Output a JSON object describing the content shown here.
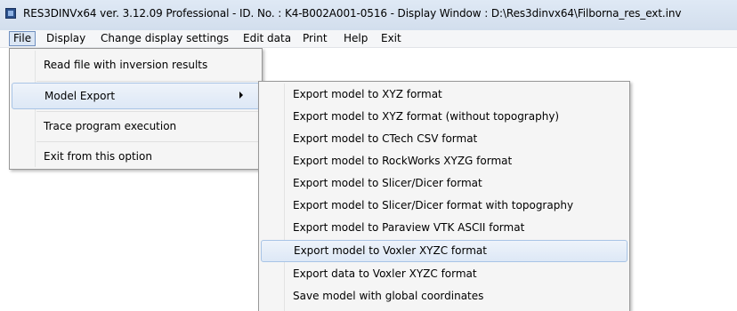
{
  "window": {
    "title": "RES3DINVx64 ver. 3.12.09 Professional - ID. No. : K4-B002A001-0516  - Display Window : D:\\Res3dinvx64\\Filborna_res_ext.inv",
    "icon": "app-icon"
  },
  "menubar": {
    "items": [
      {
        "label": "File"
      },
      {
        "label": "Display"
      },
      {
        "label": "Change display settings"
      },
      {
        "label": "Edit data"
      },
      {
        "label": "Print"
      },
      {
        "label": "Help"
      },
      {
        "label": "Exit"
      }
    ]
  },
  "file_menu": {
    "items": [
      {
        "label": "Read file with inversion results"
      },
      {
        "label": "Model Export"
      },
      {
        "label": "Trace program execution"
      },
      {
        "label": "Exit from this option"
      }
    ]
  },
  "model_export_submenu": {
    "items": [
      {
        "label": "Export model to XYZ format"
      },
      {
        "label": "Export model to XYZ format (without topography)"
      },
      {
        "label": "Export model to CTech CSV format"
      },
      {
        "label": "Export model to RockWorks XYZG format"
      },
      {
        "label": "Export model to Slicer/Dicer format"
      },
      {
        "label": "Export model to Slicer/Dicer format with topography"
      },
      {
        "label": "Export model to Paraview VTK ASCII format"
      },
      {
        "label": "Export model to Voxler XYZC format"
      },
      {
        "label": "Export data to Voxler XYZC format"
      },
      {
        "label": "Save model with global coordinates"
      }
    ]
  },
  "colors": {
    "titlebar": "#d6e2f0",
    "highlight": "#dde8f6",
    "highlight_border": "#a8c4e6"
  }
}
